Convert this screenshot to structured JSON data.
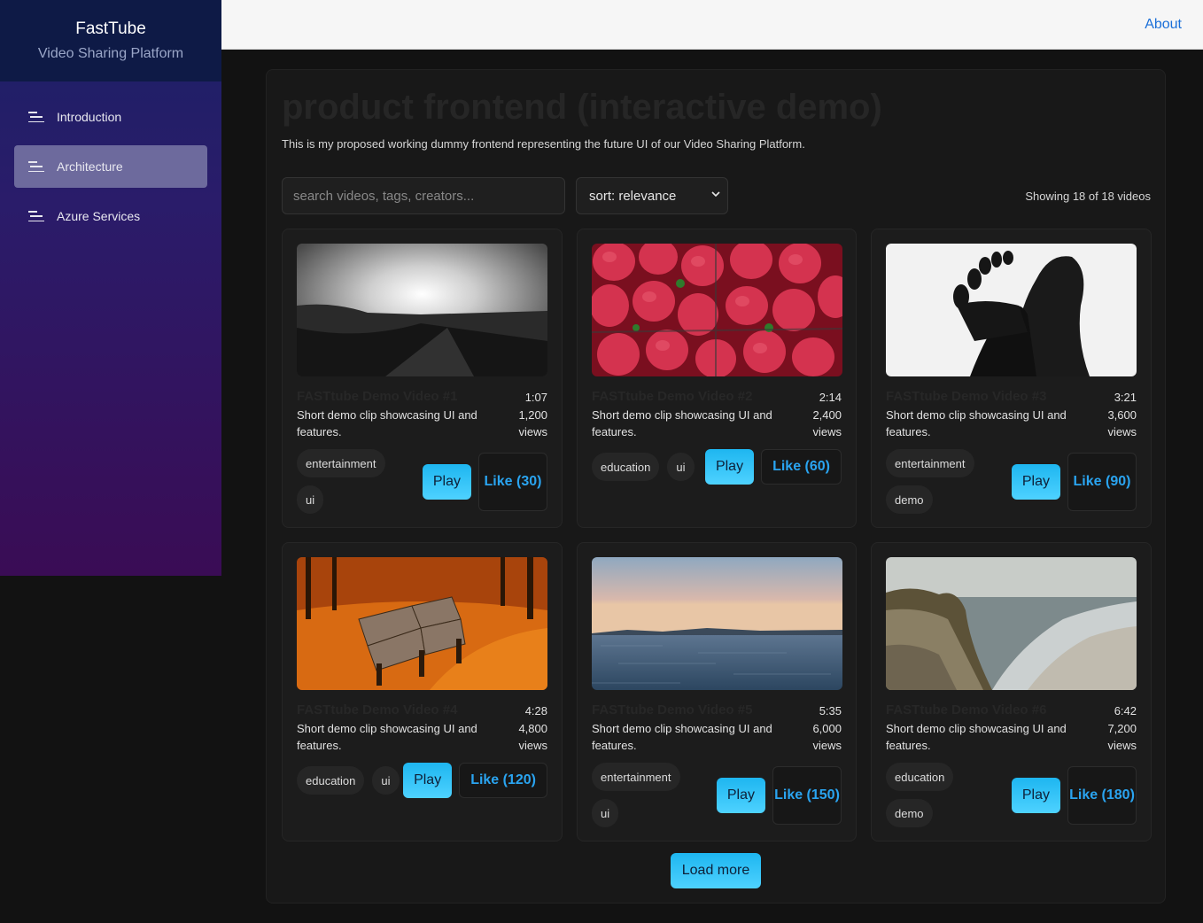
{
  "sidebar": {
    "brand": "FastTube",
    "subtitle": "Video Sharing Platform",
    "items": [
      {
        "label": "Introduction",
        "active": false
      },
      {
        "label": "Architecture",
        "active": true
      },
      {
        "label": "Azure Services",
        "active": false
      }
    ]
  },
  "topbar": {
    "about_label": "About"
  },
  "main": {
    "headline": "product frontend (interactive demo)",
    "intro": "This is my proposed working dummy frontend representing the future UI of our Video Sharing Platform.",
    "search_placeholder": "search videos, tags, creators...",
    "sort_value": "sort: relevance",
    "showing": "Showing 18 of 18 videos",
    "load_more": "Load more"
  },
  "videos": [
    {
      "title": "FASTtube Demo Video #1",
      "desc": "Short demo clip showcasing UI and features.",
      "duration": "1:07",
      "views": "1,200",
      "views_label": "views",
      "tags": [
        "entertainment",
        "ui"
      ],
      "play": "Play",
      "like": "Like (30)",
      "thumb": "landscape-bw"
    },
    {
      "title": "FASTtube Demo Video #2",
      "desc": "Short demo clip showcasing UI and features.",
      "duration": "2:14",
      "views": "2,400",
      "views_label": "views",
      "tags": [
        "education",
        "ui"
      ],
      "play": "Play",
      "like": "Like (60)",
      "thumb": "strawberries"
    },
    {
      "title": "FASTtube Demo Video #3",
      "desc": "Short demo clip showcasing UI and features.",
      "duration": "3:21",
      "views": "3,600",
      "views_label": "views",
      "tags": [
        "entertainment",
        "demo"
      ],
      "play": "Play",
      "like": "Like (90)",
      "thumb": "feet-silhouette"
    },
    {
      "title": "FASTtube Demo Video #4",
      "desc": "Short demo clip showcasing UI and features.",
      "duration": "4:28",
      "views": "4,800",
      "views_label": "views",
      "tags": [
        "education",
        "ui"
      ],
      "play": "Play",
      "like": "Like (120)",
      "thumb": "autumn-bench"
    },
    {
      "title": "FASTtube Demo Video #5",
      "desc": "Short demo clip showcasing UI and features.",
      "duration": "5:35",
      "views": "6,000",
      "views_label": "views",
      "tags": [
        "entertainment",
        "ui"
      ],
      "play": "Play",
      "like": "Like (150)",
      "thumb": "sea-sunset"
    },
    {
      "title": "FASTtube Demo Video #6",
      "desc": "Short demo clip showcasing UI and features.",
      "duration": "6:42",
      "views": "7,200",
      "views_label": "views",
      "tags": [
        "education",
        "demo"
      ],
      "play": "Play",
      "like": "Like (180)",
      "thumb": "coast-cliff"
    }
  ],
  "colors": {
    "accent": "#2aa4f0",
    "play_gradient_top": "#1eb6f0",
    "about_link": "#1a6fd8",
    "sidebar_active": "#6d6a9d"
  }
}
